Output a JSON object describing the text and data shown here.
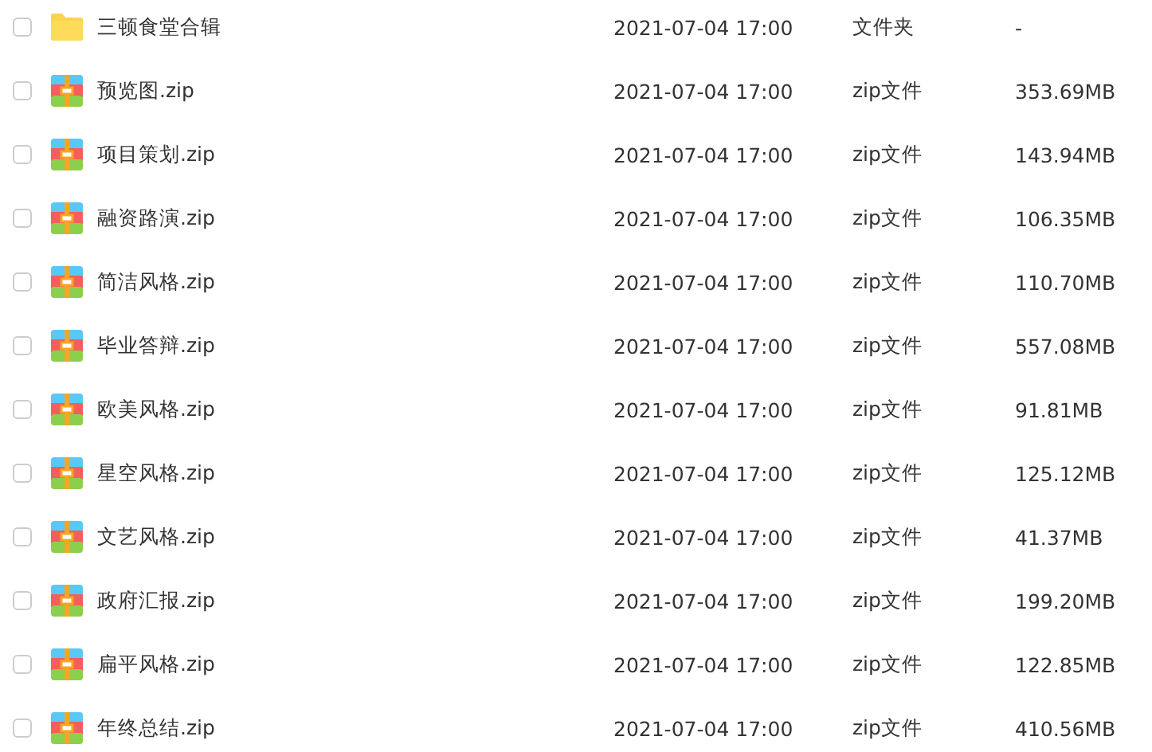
{
  "files": [
    {
      "kind": "folder",
      "name": "三顿食堂合辑",
      "modified": "2021-07-04 17:00",
      "type": "文件夹",
      "size": "-",
      "checked": false
    },
    {
      "kind": "zip",
      "name": "预览图.zip",
      "modified": "2021-07-04 17:00",
      "type": "zip文件",
      "size": "353.69MB",
      "checked": false
    },
    {
      "kind": "zip",
      "name": "项目策划.zip",
      "modified": "2021-07-04 17:00",
      "type": "zip文件",
      "size": "143.94MB",
      "checked": false
    },
    {
      "kind": "zip",
      "name": "融资路演.zip",
      "modified": "2021-07-04 17:00",
      "type": "zip文件",
      "size": "106.35MB",
      "checked": false
    },
    {
      "kind": "zip",
      "name": "简洁风格.zip",
      "modified": "2021-07-04 17:00",
      "type": "zip文件",
      "size": "110.70MB",
      "checked": false
    },
    {
      "kind": "zip",
      "name": "毕业答辩.zip",
      "modified": "2021-07-04 17:00",
      "type": "zip文件",
      "size": "557.08MB",
      "checked": false
    },
    {
      "kind": "zip",
      "name": "欧美风格.zip",
      "modified": "2021-07-04 17:00",
      "type": "zip文件",
      "size": "91.81MB",
      "checked": false
    },
    {
      "kind": "zip",
      "name": "星空风格.zip",
      "modified": "2021-07-04 17:00",
      "type": "zip文件",
      "size": "125.12MB",
      "checked": false
    },
    {
      "kind": "zip",
      "name": "文艺风格.zip",
      "modified": "2021-07-04 17:00",
      "type": "zip文件",
      "size": "41.37MB",
      "checked": false
    },
    {
      "kind": "zip",
      "name": "政府汇报.zip",
      "modified": "2021-07-04 17:00",
      "type": "zip文件",
      "size": "199.20MB",
      "checked": false
    },
    {
      "kind": "zip",
      "name": "扁平风格.zip",
      "modified": "2021-07-04 17:00",
      "type": "zip文件",
      "size": "122.85MB",
      "checked": false
    },
    {
      "kind": "zip",
      "name": "年终总结.zip",
      "modified": "2021-07-04 17:00",
      "type": "zip文件",
      "size": "410.56MB",
      "checked": false
    }
  ]
}
